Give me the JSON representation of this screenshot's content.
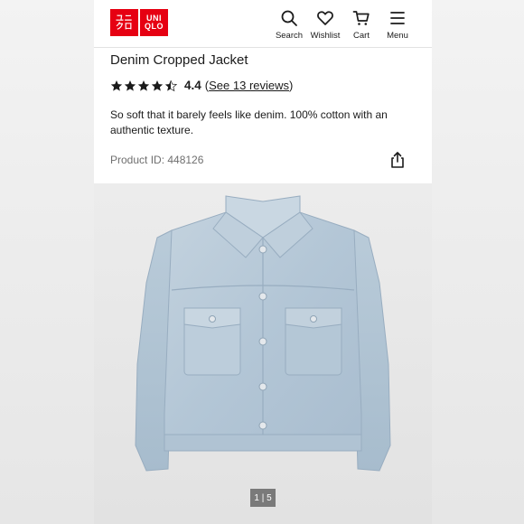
{
  "brand": {
    "logo_top": "ユニクロ",
    "logo_bottom": "UNIQLO",
    "color": "#e60012"
  },
  "nav": {
    "items": [
      {
        "label": "Search",
        "icon": "search-icon"
      },
      {
        "label": "Wishlist",
        "icon": "heart-icon"
      },
      {
        "label": "Cart",
        "icon": "cart-icon"
      },
      {
        "label": "Menu",
        "icon": "hamburger-icon"
      }
    ]
  },
  "product": {
    "title": "Denim Cropped Jacket",
    "rating": 4.4,
    "rating_label": "4.4",
    "stars_filled": 4.5,
    "reviews_paren_open": "(",
    "reviews_link": "See 13 reviews",
    "reviews_paren_close": ")",
    "description": "So soft that it barely feels like denim. 100% cotton with an authentic texture.",
    "product_id": "Product ID: 448126"
  },
  "gallery": {
    "pager": "1 | 5",
    "current": 1,
    "total": 5
  }
}
